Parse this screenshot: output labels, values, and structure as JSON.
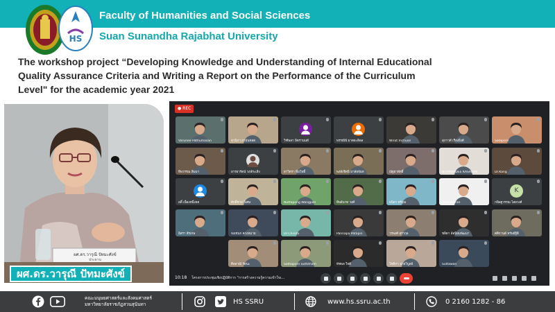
{
  "header": {
    "faculty": "Faculty of Humanities and Social Sciences",
    "university": "Suan Sunandha Rajabhat University",
    "brand_color": "#12b0b7"
  },
  "headline": {
    "line1": "The workshop project “Developing Knowledge and Understanding of Internal Educational",
    "line2": "Quality Assurance Criteria and Writing a Report on the Performance of the Curriculum",
    "line3": "Level\" for the academic year 2021"
  },
  "speaker": {
    "name": "ผศ.ดร.วารุณี ปัทมะศังข์",
    "nameplate": "ผศ.ดร.วารุณี ปัทมะศังข์",
    "nameplate_role": "ประธาน"
  },
  "meeting": {
    "rec_label": "REC",
    "time": "10:18",
    "meeting_title": "โครงการประชุมเชิงปฏิบัติการ \"การสร้างความรู้ความเข้าใจเ...",
    "participants": [
      {
        "name": "Varunee Pathumasan",
        "kind": "video",
        "bg": "#5b6f6c"
      },
      {
        "name": "สุวนิภา ยามันหลด",
        "kind": "video",
        "bg": "#b7a68b"
      },
      {
        "name": "วิฑ์พลา มิตรานนท์",
        "kind": "avatar",
        "color": "#7b1fa2"
      },
      {
        "name": "พรรณีนี มาตยะดิลล",
        "kind": "avatar",
        "color": "#ef6c00"
      },
      {
        "name": "Wirut Inchuan",
        "kind": "video",
        "bg": "#3c3a37"
      },
      {
        "name": "สุภาวดี เรืองยิ่งดี",
        "kind": "video",
        "bg": "#4b4b4b"
      },
      {
        "name": "Sataporn",
        "kind": "video",
        "bg": "#c98f6c"
      },
      {
        "name": "ทิพวรรณ สิมมา",
        "kind": "video",
        "bg": "#6c5a4b"
      },
      {
        "name": "อารยารัตน์ วงษ์ระเสิง",
        "kind": "avatar-img",
        "color": "#e0e0e0"
      },
      {
        "name": "สาวิตรา พิ่มโพธิ์",
        "kind": "video",
        "bg": "#8a7a63"
      },
      {
        "name": "พงษ์เชิดนิ มาลัยจันท",
        "kind": "video",
        "bg": "#7a6e57"
      },
      {
        "name": "ณัฐยาพัทธิ์",
        "kind": "video",
        "bg": "#7d6d6b"
      },
      {
        "name": "NITHIWADEE KASAISIN",
        "kind": "video",
        "bg": "#e3ddd8"
      },
      {
        "name": "Dr.Kang",
        "kind": "video",
        "bg": "#5c4a3c"
      },
      {
        "name": "อดิ์ เนื่องหนึ่งจด",
        "kind": "avatar",
        "color": "#1e88e5"
      },
      {
        "name": "ศักดิ์ชาย วิเศษ",
        "kind": "video",
        "bg": "#bfb49a"
      },
      {
        "name": "Nuttapong Wangpan",
        "kind": "video",
        "bg": "#6fa36a"
      },
      {
        "name": "ทิพย์นาท วงศ์",
        "kind": "video",
        "bg": "#526b48"
      },
      {
        "name": "ธนิดา ตรีงุณ",
        "kind": "video",
        "bg": "#7fb6c8"
      },
      {
        "name": "Vadhasaran",
        "kind": "video",
        "bg": "#f0f0f0"
      },
      {
        "name": "กนิษฐวรรณ ไสยวงศ์",
        "kind": "avatar",
        "color": "#c5e1a5",
        "letter": "K"
      },
      {
        "name": "อิสรา สีรเกษ",
        "kind": "video",
        "bg": "#4e6e7c"
      },
      {
        "name": "จงเชนก ควงหมาย",
        "kind": "video",
        "bg": "#3f4a5a"
      },
      {
        "name": "Dr.Chinda",
        "kind": "video",
        "bg": "#76b7aa"
      },
      {
        "name": "Pannapa Patapin",
        "kind": "video",
        "bg": "#3a3a3a"
      },
      {
        "name": "วรพงศ์ สุรากุล",
        "kind": "video",
        "bg": "#8c7f72"
      },
      {
        "name": "ชลิตา ล้อนิยมพัฒนา",
        "kind": "video",
        "bg": "#2e2e2e"
      },
      {
        "name": "ศศิกานต์ ทรัพย์ฐิติ",
        "kind": "video",
        "bg": "#6e6b5f"
      },
      {
        "name": "ศิลลาณี รัตนะ",
        "kind": "video",
        "bg": "#a18d78"
      },
      {
        "name": "Sathaporn Suttitham",
        "kind": "video",
        "bg": "#8c9a7a"
      },
      {
        "name": "ทัชพล ใจดี",
        "kind": "video",
        "bg": "#2b2b2b"
      },
      {
        "name": "โชติกา ฉายวิบูลย์",
        "kind": "video",
        "bg": "#b9a89a"
      },
      {
        "name": "Suttawan",
        "kind": "video",
        "bg": "#3a4a5a"
      }
    ]
  },
  "footer": {
    "faculty_line1": "คณะมนุษยศาสตร์และสังคมศาสตร์",
    "faculty_line2": "มหาวิทยาลัยราชภัฏสวนสุนันทา",
    "social_handle": "HS SSRU",
    "website": "www.hs.ssru.ac.th",
    "phone": "0  2160 1282 - 86",
    "icons": [
      "facebook-icon",
      "youtube-icon",
      "instagram-icon",
      "twitter-icon",
      "globe-icon",
      "phone-icon"
    ]
  }
}
